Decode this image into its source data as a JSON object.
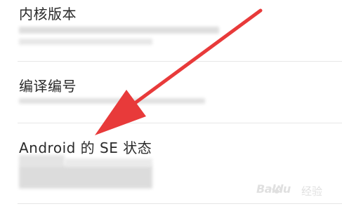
{
  "settings_list": {
    "items": [
      {
        "title": "内核版本"
      },
      {
        "title": "编译编号"
      },
      {
        "title": "Android 的 SE 状态"
      }
    ]
  },
  "watermark": {
    "brand": "Baidu",
    "suffix": "经验"
  },
  "colors": {
    "arrow": "#e83a3a",
    "title_text": "#2a2a2a",
    "divider": "#e6e6e6",
    "redacted": "#d8d8d8"
  }
}
